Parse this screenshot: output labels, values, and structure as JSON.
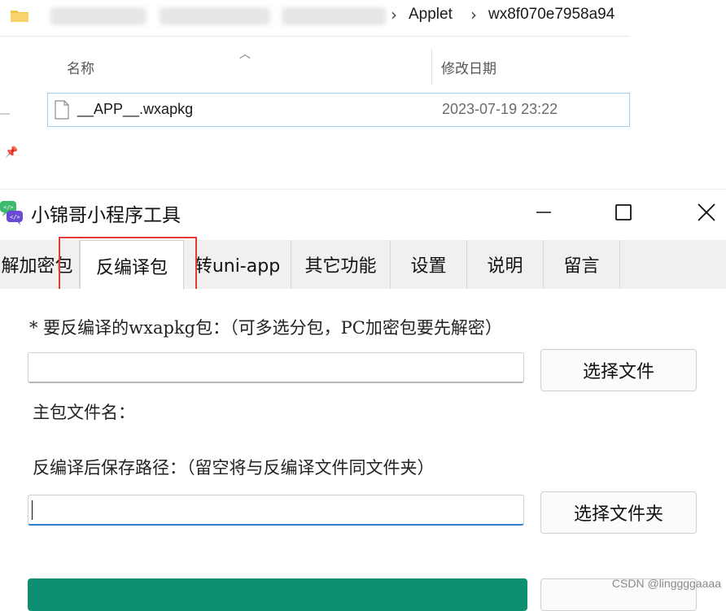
{
  "explorer": {
    "breadcrumb": {
      "visible_segment_1": "Applet",
      "visible_segment_2": "wx8f070e7958a94"
    },
    "columns": {
      "name": "名称",
      "date": "修改日期"
    },
    "files": [
      {
        "name": "__APP__.wxapkg",
        "modified": "2023-07-19 23:22"
      }
    ]
  },
  "app": {
    "title": "小锦哥小程序工具",
    "tabs": [
      {
        "label": "解加密包"
      },
      {
        "label": "反编译包",
        "active": true
      },
      {
        "label": "转uni-app"
      },
      {
        "label": "其它功能"
      },
      {
        "label": "设置"
      },
      {
        "label": "说明"
      },
      {
        "label": "留言"
      }
    ],
    "form": {
      "package_label": "* 要反编译的wxapkg包：（可多选分包，PC加密包要先解密）",
      "package_value": "",
      "choose_file_button": "选择文件",
      "main_package_label": "主包文件名：",
      "save_path_label": "反编译后保存路径：（留空将与反编译文件同文件夹）",
      "save_path_value": "",
      "choose_folder_button": "选择文件夹"
    }
  },
  "watermark": "CSDN @linggggaaaa",
  "colors": {
    "highlight_box": "#e43b3b",
    "primary_button": "#0f8f72",
    "focus_underline": "#2e7fd0",
    "folder_icon": "#f2c24c"
  }
}
